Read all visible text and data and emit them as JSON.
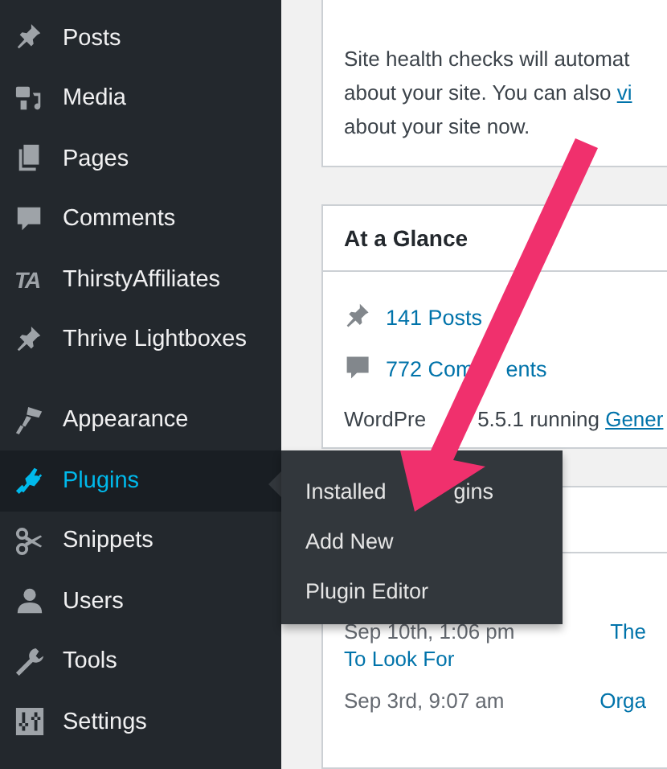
{
  "sidebar": {
    "items": [
      {
        "label": "Posts",
        "kind": "pin",
        "selected": false
      },
      {
        "label": "Media",
        "kind": "media",
        "selected": false
      },
      {
        "label": "Pages",
        "kind": "pages",
        "selected": false
      },
      {
        "label": "Comments",
        "kind": "comment",
        "selected": false
      },
      {
        "label": "ThirstyAffiliates",
        "kind": "ta",
        "icon_text": "TA",
        "selected": false
      },
      {
        "label": "Thrive Lightboxes",
        "kind": "pin",
        "selected": false
      },
      {
        "label": "Appearance",
        "kind": "brush",
        "selected": false
      },
      {
        "label": "Plugins",
        "kind": "plug",
        "selected": true
      },
      {
        "label": "Snippets",
        "kind": "scissors",
        "selected": false
      },
      {
        "label": "Users",
        "kind": "user",
        "selected": false
      },
      {
        "label": "Tools",
        "kind": "wrench",
        "selected": false
      },
      {
        "label": "Settings",
        "kind": "sliders",
        "selected": false
      }
    ]
  },
  "flyout_menu": {
    "items": [
      {
        "parts": [
          "Installed",
          "gins"
        ]
      },
      {
        "parts": [
          "Add New"
        ]
      },
      {
        "parts": [
          "Plugin Editor"
        ]
      }
    ]
  },
  "site_health": {
    "lines": [
      {
        "text": "Site health checks will automat"
      },
      {
        "text": "about your site. You can also ",
        "link": "vi"
      },
      {
        "text": "about your site now."
      }
    ]
  },
  "at_a_glance": {
    "title": "At a Glance",
    "stats": [
      {
        "kind": "pin",
        "parts": [
          "141 Posts"
        ]
      },
      {
        "kind": "comment",
        "parts": [
          "772 Com",
          "ents"
        ]
      }
    ],
    "version_parts": [
      "WordPre",
      "5.5.1 running "
    ],
    "version_link": "Gener"
  },
  "activity": {
    "rows": [
      {
        "date": "Sep 10th, 1:06 pm",
        "title": "The",
        "title_continued": "To Look For"
      },
      {
        "date": "Sep 3rd, 9:07 am",
        "title": "Orga"
      }
    ]
  }
}
